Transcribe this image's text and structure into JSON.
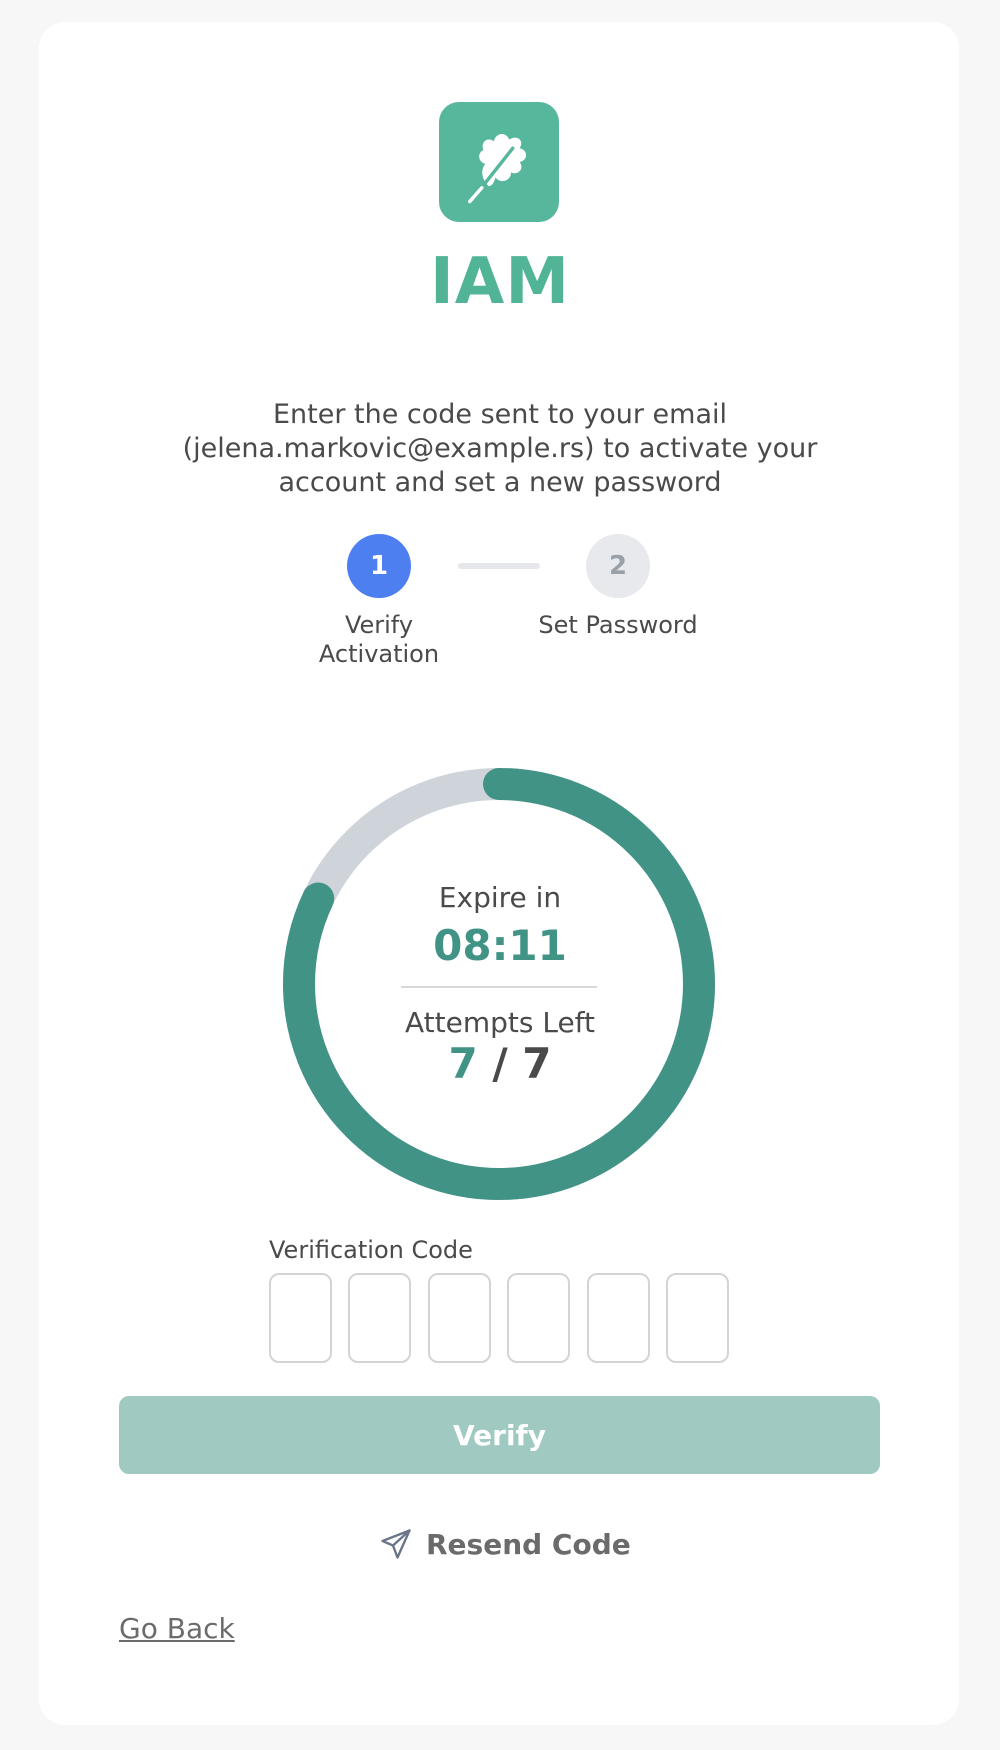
{
  "brand": {
    "name": "IAM",
    "logo_icon": "oak-leaf-icon",
    "accent_color": "#52b497"
  },
  "instructions": "Enter the code sent to your email (jelena.markovic@example.rs) to activate your account and set a new password",
  "steps": [
    {
      "number": "1",
      "label": "Verify Activation",
      "status": "active",
      "color": "#4d7ff1"
    },
    {
      "number": "2",
      "label": "Set Password",
      "status": "inactive"
    }
  ],
  "timer": {
    "expire_label": "Expire in",
    "time_remaining": "08:11",
    "progress_fraction": 0.82,
    "progress_color": "#419386",
    "track_color": "#cfd4da"
  },
  "attempts": {
    "label": "Attempts Left",
    "left": "7",
    "separator": "/",
    "total": "7"
  },
  "verification": {
    "label": "Verification Code",
    "digits": [
      "",
      "",
      "",
      "",
      "",
      ""
    ]
  },
  "verify_button": {
    "label": "Verify",
    "color": "#a0c9c2"
  },
  "resend": {
    "label": "Resend Code",
    "icon": "send-icon"
  },
  "go_back": {
    "label": "Go Back"
  }
}
